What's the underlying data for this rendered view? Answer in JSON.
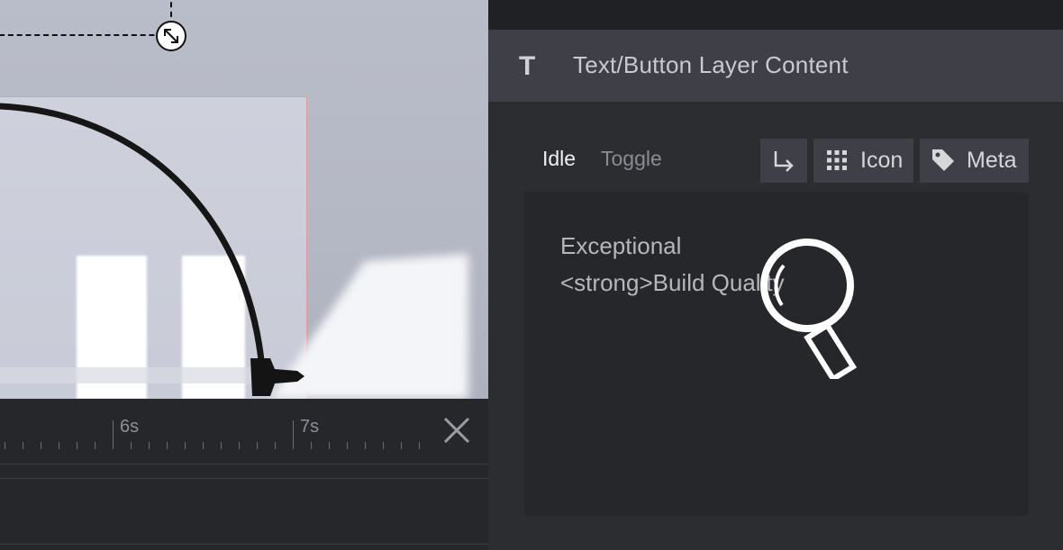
{
  "panel": {
    "title": "Text/Button Layer Content",
    "title_icon": "T",
    "tabs": [
      {
        "label": "Idle",
        "active": true
      },
      {
        "label": "Toggle",
        "active": false
      }
    ],
    "toolbar": {
      "insert_break_icon": "arrow-down-right-icon",
      "icon_label": "Icon",
      "meta_label": "Meta"
    },
    "editor": {
      "line1": "Exceptional",
      "line2": "<strong>Build Quality"
    }
  },
  "timeline": {
    "labels": [
      "6s",
      "7s"
    ]
  },
  "colors": {
    "panel_bg": "#2c2d31",
    "header_bg": "#3e3f47",
    "editor_bg": "#26272b",
    "layer_border": "#e79a9a"
  }
}
